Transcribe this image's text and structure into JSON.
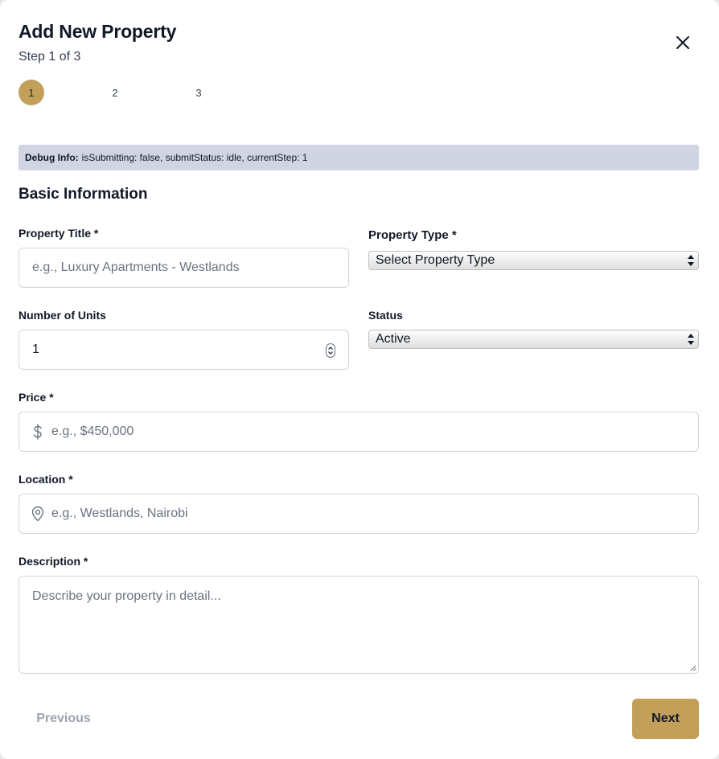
{
  "modal": {
    "title": "Add New Property",
    "step_text": "Step 1 of 3",
    "steps": [
      "1",
      "2",
      "3"
    ],
    "active_step": 1,
    "accent_color": "#c2a05a"
  },
  "debug": {
    "label": "Debug Info:",
    "text": "isSubmitting: false, submitStatus: idle, currentStep: 1"
  },
  "section_title": "Basic Information",
  "fields": {
    "property_title": {
      "label": "Property Title *",
      "placeholder": "e.g., Luxury Apartments - Westlands"
    },
    "property_type": {
      "label": "Property Type *",
      "value": "Select Property Type"
    },
    "units": {
      "label": "Number of Units",
      "value": "1"
    },
    "status": {
      "label": "Status",
      "value": "Active"
    },
    "price": {
      "label": "Price *",
      "placeholder": "e.g., $450,000",
      "icon": "dollar-icon"
    },
    "location": {
      "label": "Location *",
      "placeholder": "e.g., Westlands, Nairobi",
      "icon": "map-pin-icon"
    },
    "description": {
      "label": "Description *",
      "placeholder": "Describe your property in detail..."
    }
  },
  "buttons": {
    "previous": "Previous",
    "next": "Next"
  }
}
